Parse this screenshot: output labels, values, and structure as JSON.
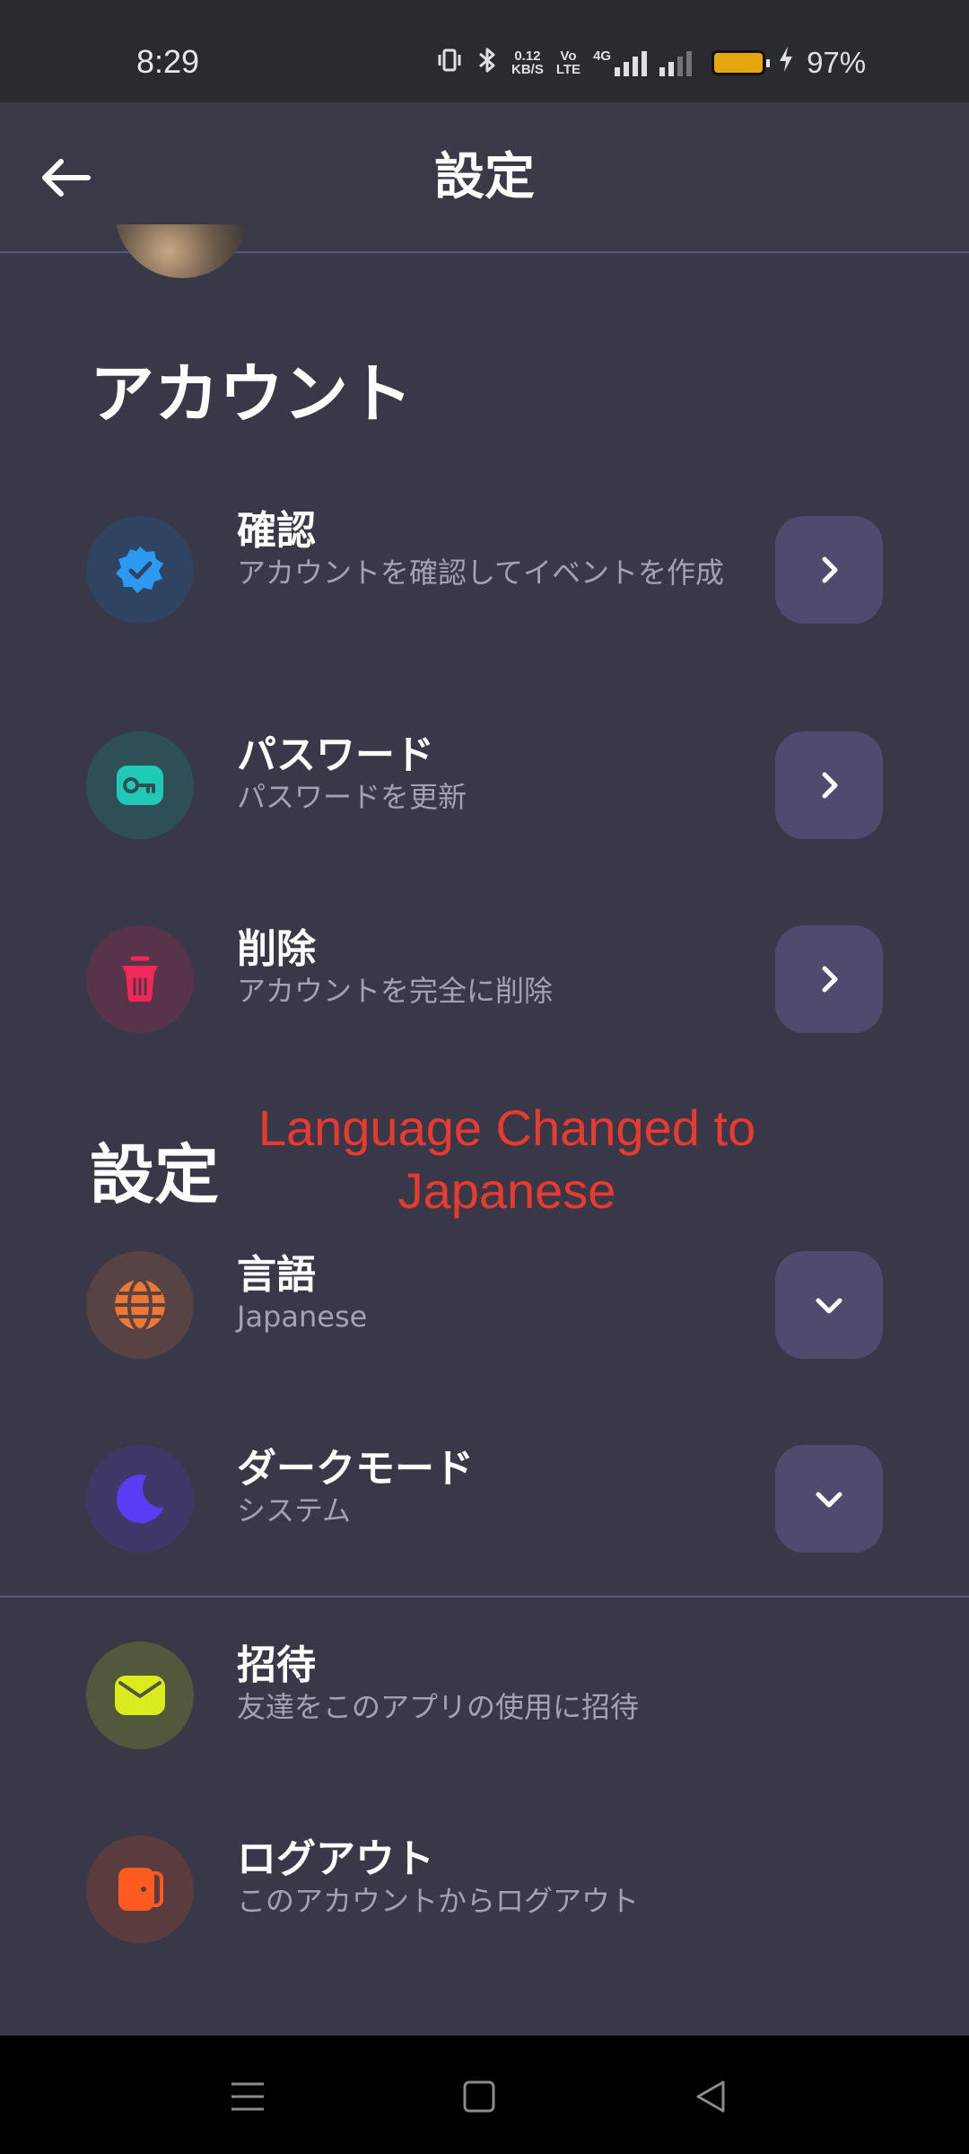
{
  "status_bar": {
    "time": "8:29",
    "net_speed_value": "0.12",
    "net_speed_unit": "KB/S",
    "volte_top": "Vo",
    "volte_bottom": "LTE",
    "network": "4G",
    "battery_percent": "97%",
    "battery_color": "#e6a60f"
  },
  "app_bar": {
    "title": "設定",
    "back_icon": "arrow-left-icon"
  },
  "account_section": {
    "title": "アカウント",
    "items": [
      {
        "title": "確認",
        "subtitle": "アカウントを確認してイベントを作成",
        "icon": "verified-badge-icon",
        "icon_color": "#2b9af3",
        "icon_bg": "#2f4460",
        "action_icon": "chevron-right-icon"
      },
      {
        "title": "パスワード",
        "subtitle": "パスワードを更新",
        "icon": "key-icon",
        "icon_color": "#20c9b6",
        "icon_bg": "#2f4f57",
        "action_icon": "chevron-right-icon"
      },
      {
        "title": "削除",
        "subtitle": "アカウントを完全に削除",
        "icon": "trash-icon",
        "icon_color": "#f2285a",
        "icon_bg": "#573448",
        "action_icon": "chevron-right-icon"
      }
    ]
  },
  "settings_section": {
    "title": "設定",
    "items": [
      {
        "title": "言語",
        "subtitle": "Japanese",
        "icon": "globe-icon",
        "icon_color": "#f07634",
        "icon_bg": "#574244",
        "action_icon": "chevron-down-icon"
      },
      {
        "title": "ダークモード",
        "subtitle": "システム",
        "icon": "moon-icon",
        "icon_color": "#5b3cf5",
        "icon_bg": "#3e3868",
        "action_icon": "chevron-down-icon"
      }
    ]
  },
  "other_items": [
    {
      "title": "招待",
      "subtitle": "友達をこのアプリの使用に招待",
      "icon": "envelope-icon",
      "icon_color": "#d9ec1d",
      "icon_bg": "#52583b"
    },
    {
      "title": "ログアウト",
      "subtitle": "このアカウントからログアウト",
      "icon": "logout-icon",
      "icon_color": "#ff5a1f",
      "icon_bg": "#5a3c3e"
    }
  ],
  "annotation": "Language Changed to Japanese",
  "nav_bar": {
    "menu_icon": "menu-icon",
    "home_icon": "square-home-icon",
    "back_icon": "triangle-back-icon"
  }
}
